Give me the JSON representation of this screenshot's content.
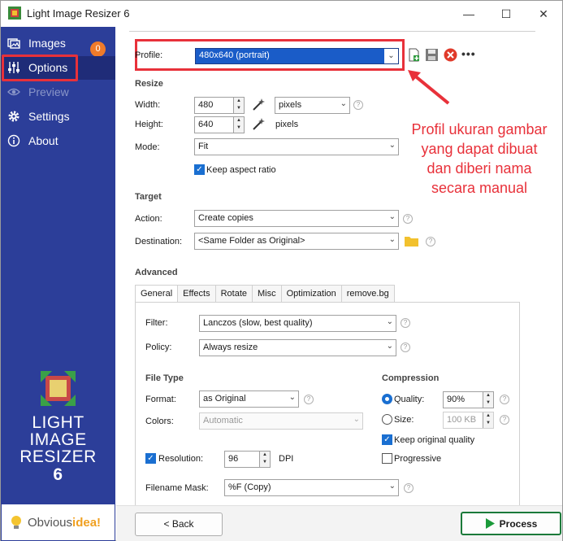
{
  "window": {
    "title": "Light Image Resizer 6",
    "minimize_icon": "minimize-icon",
    "maximize_icon": "maximize-icon",
    "close_icon": "close-icon"
  },
  "sidebar": {
    "items": [
      {
        "label": "Images",
        "icon": "images-icon",
        "badge": "0"
      },
      {
        "label": "Options",
        "icon": "sliders-icon"
      },
      {
        "label": "Preview",
        "icon": "eye-icon"
      },
      {
        "label": "Settings",
        "icon": "gear-icon"
      },
      {
        "label": "About",
        "icon": "info-icon"
      }
    ],
    "logo": {
      "line1": "LIGHT",
      "line2": "IMAGE",
      "line3": "RESIZER",
      "number": "6"
    },
    "brand": {
      "part1": "Obvious",
      "part2": "idea!"
    }
  },
  "profile": {
    "label": "Profile:",
    "value": "480x640 (portrait)"
  },
  "resize": {
    "heading": "Resize",
    "width_label": "Width:",
    "width_value": "480",
    "width_unit": "pixels",
    "height_label": "Height:",
    "height_value": "640",
    "height_unit": "pixels",
    "mode_label": "Mode:",
    "mode_value": "Fit",
    "keep_aspect_label": "Keep aspect ratio"
  },
  "target": {
    "heading": "Target",
    "action_label": "Action:",
    "action_value": "Create copies",
    "destination_label": "Destination:",
    "destination_value": "<Same Folder as Original>"
  },
  "advanced": {
    "heading": "Advanced",
    "tabs": [
      "General",
      "Effects",
      "Rotate",
      "Misc",
      "Optimization",
      "remove.bg"
    ],
    "filter_label": "Filter:",
    "filter_value": "Lanczos  (slow, best quality)",
    "policy_label": "Policy:",
    "policy_value": "Always resize",
    "file_type_heading": "File Type",
    "format_label": "Format:",
    "format_value": "as Original",
    "colors_label": "Colors:",
    "colors_value": "Automatic",
    "resolution_label": "Resolution:",
    "resolution_value": "96",
    "resolution_unit": "DPI",
    "filename_mask_label": "Filename Mask:",
    "filename_mask_value": "%F (Copy)",
    "compression_heading": "Compression",
    "quality_label": "Quality:",
    "quality_value": "90%",
    "size_label": "Size:",
    "size_value": "100 KB",
    "keep_quality_label": "Keep original quality",
    "progressive_label": "Progressive"
  },
  "annotation": {
    "text": "Profil ukuran gambar yang dapat dibuat dan diberi nama secara manual"
  },
  "buttons": {
    "back": "< Back",
    "process": "Process"
  },
  "colors": {
    "sidebar": "#2c3e99",
    "highlight": "#e8313a",
    "selection": "#1a5cc8",
    "process_green": "#1b7a3a"
  }
}
